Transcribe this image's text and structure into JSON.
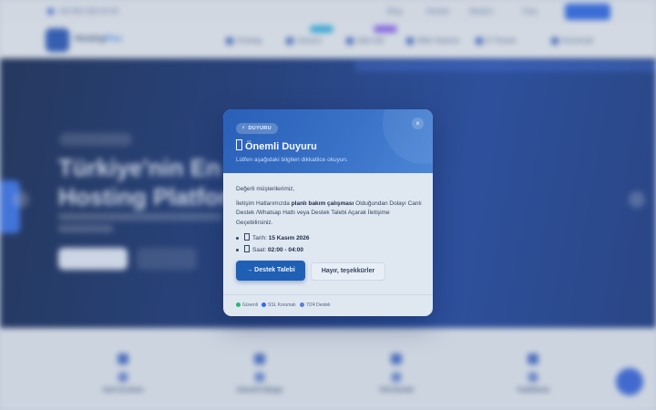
{
  "background": {
    "topbar": {
      "contact": "+90 850 000 00 00",
      "links": [
        "Blog",
        "Destek",
        "Müşteri",
        "Giriş"
      ],
      "cta": ""
    },
    "brand": {
      "name_a": "Hosting",
      "name_b": "Plus"
    },
    "nav": [
      "Hosting",
      "Sunucu",
      "Alan Adı",
      "Web Tasarım",
      "E-Ticaret",
      "Kurumsal"
    ],
    "hero": {
      "title": "Türkiye'nin En Hızlı Hosting Platformu"
    },
    "features": [
      "Hızlı Kurulum",
      "Güvenli Altyapı",
      "7/24 Destek",
      "Yedekleme"
    ]
  },
  "modal": {
    "badge": "DUYURU",
    "title": "Önemli Duyuru",
    "subtitle": "Lütfen aşağıdaki bilgileri dikkatlice okuyun.",
    "greeting": "Değerli müşterilerimiz,",
    "body_pre": "İletişim Hatlarımızda ",
    "body_bold": "planlı bakım çalışması",
    "body_post": " Olduğundan Dolayı Canlı Destek /Whatsap Hattı veya Destek Talebi Açarak İletişime Geçebilirsiniz.",
    "items": [
      {
        "label": "Tarih:",
        "value": "15 Kasım 2026"
      },
      {
        "label": "Saat:",
        "value": "02:00 - 04:00"
      }
    ],
    "primary_button": "Destek Talebi",
    "secondary_button": "Hayır, teşekkürler",
    "footer": [
      {
        "label": "Güvenli",
        "color": "#2bb673"
      },
      {
        "label": "SSL Korumalı",
        "color": "#2f6cf0"
      },
      {
        "label": "7/24 Destek",
        "color": "#5b7fd1"
      }
    ]
  }
}
